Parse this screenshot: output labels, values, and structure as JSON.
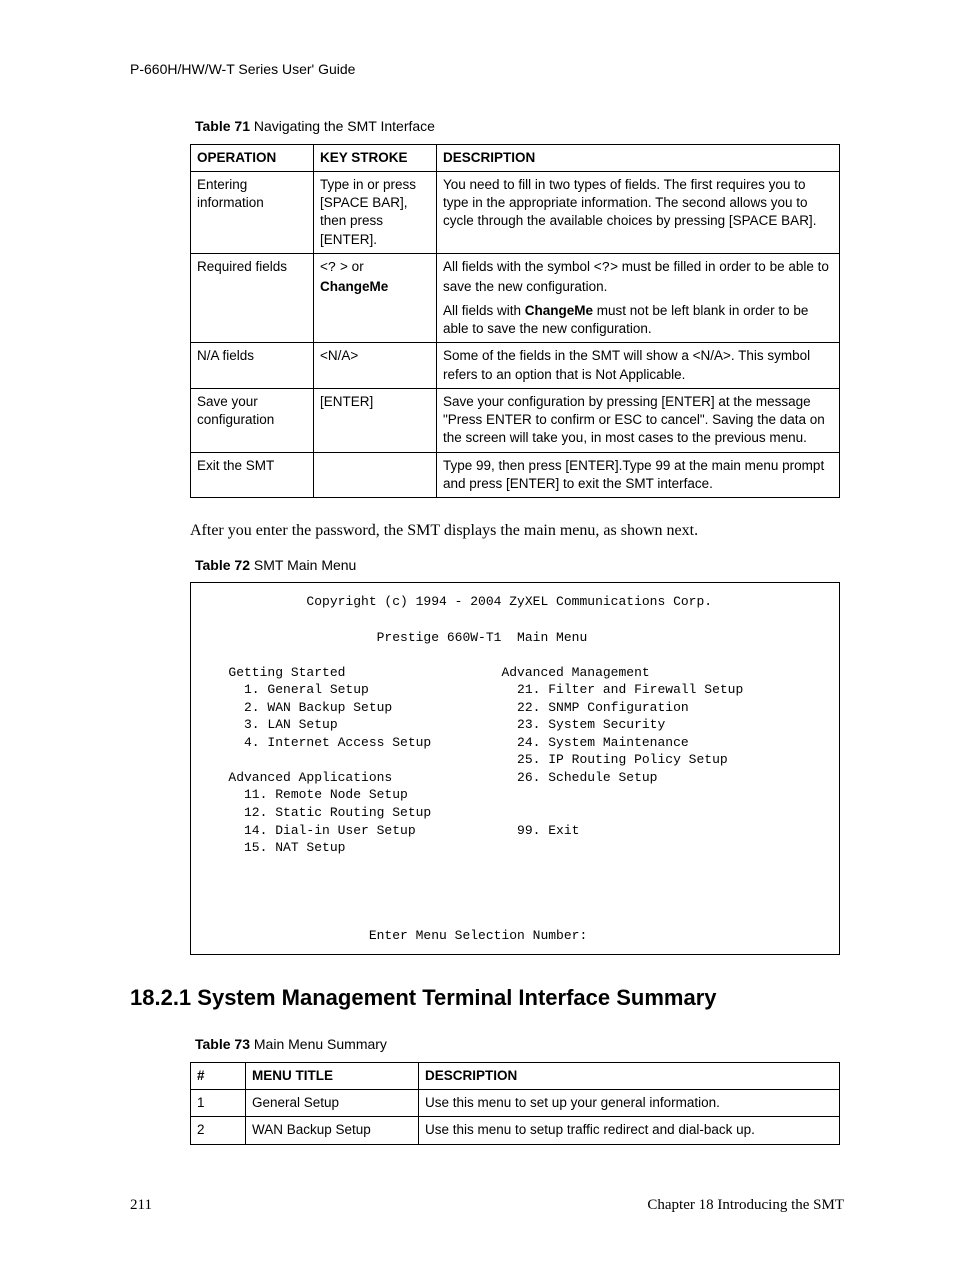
{
  "header": "P-660H/HW/W-T Series User' Guide",
  "table71": {
    "caption_bold": "Table 71",
    "caption_rest": "   Navigating the SMT Interface",
    "headers": [
      "OPERATION",
      "KEY STROKE",
      "DESCRIPTION"
    ],
    "rows": [
      {
        "op": "Entering information",
        "key": "Type in or press [SPACE BAR], then press [ENTER].",
        "desc": "You need to fill in two types of fields. The first requires you to type in the appropriate information. The second allows you to cycle through the available choices by pressing [SPACE BAR]."
      },
      {
        "op": "Required fields",
        "key_prefix": "<",
        "key_symbol": "?",
        "key_mid": " > or ",
        "key_bold": "ChangeMe",
        "desc_p1_a": "All fields with the symbol <",
        "desc_p1_b": "?",
        "desc_p1_c": "> must be filled in order to be able to save the new configuration.",
        "desc_p2_a": "All fields with ",
        "desc_p2_bold": "ChangeMe",
        "desc_p2_b": " must not be left blank in order to be able to save the new configuration."
      },
      {
        "op": "N/A fields",
        "key": "<N/A>",
        "desc": "Some of the fields in the SMT will show a <N/A>. This symbol refers to an option that is Not Applicable."
      },
      {
        "op": "Save your configuration",
        "key": "[ENTER]",
        "desc": "Save your configuration by pressing [ENTER] at the message \"Press ENTER to confirm or ESC to cancel\". Saving the data on the screen will take you, in most cases to the previous menu."
      },
      {
        "op": "Exit the SMT",
        "key": "",
        "desc": "Type 99, then press [ENTER].Type 99 at the main menu prompt and press [ENTER] to exit the SMT interface."
      }
    ]
  },
  "para_after_t71": "After you enter the password, the SMT displays the main menu, as shown next.",
  "table72": {
    "caption_bold": "Table 72",
    "caption_rest": "   SMT Main Menu"
  },
  "terminal": "             Copyright (c) 1994 - 2004 ZyXEL Communications Corp.\n\n                      Prestige 660W-T1  Main Menu\n\n   Getting Started                    Advanced Management\n     1. General Setup                   21. Filter and Firewall Setup\n     2. WAN Backup Setup                22. SNMP Configuration\n     3. LAN Setup                       23. System Security\n     4. Internet Access Setup           24. System Maintenance\n                                        25. IP Routing Policy Setup\n   Advanced Applications                26. Schedule Setup\n     11. Remote Node Setup\n     12. Static Routing Setup\n     14. Dial-in User Setup             99. Exit\n     15. NAT Setup\n\n\n\n\n                     Enter Menu Selection Number:",
  "section_heading": "18.2.1  System Management Terminal Interface Summary",
  "table73": {
    "caption_bold": "Table 73",
    "caption_rest": "   Main Menu Summary",
    "headers": [
      "#",
      "MENU TITLE",
      "DESCRIPTION"
    ],
    "rows": [
      {
        "num": "1",
        "title": "General Setup",
        "desc": "Use this menu to set up your general information."
      },
      {
        "num": "2",
        "title": "WAN Backup Setup",
        "desc": "Use this menu to setup traffic redirect and dial-back up."
      }
    ]
  },
  "footer": {
    "page": "211",
    "chapter": "Chapter 18 Introducing the SMT"
  }
}
